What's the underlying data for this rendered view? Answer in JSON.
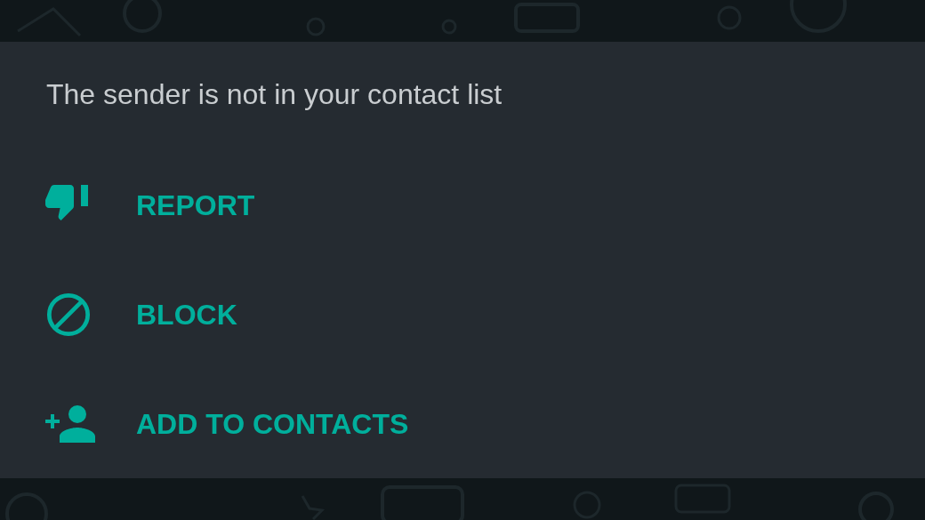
{
  "notice": {
    "message": "The sender is not in your contact list"
  },
  "actions": [
    {
      "kind": "report",
      "label": "REPORT"
    },
    {
      "kind": "block",
      "label": "BLOCK"
    },
    {
      "kind": "add",
      "label": "ADD TO CONTACTS"
    }
  ]
}
